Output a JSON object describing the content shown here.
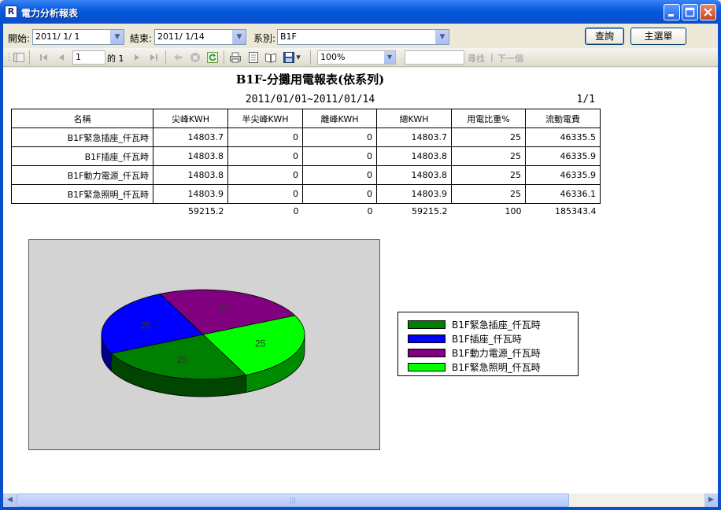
{
  "window": {
    "title": "電力分析報表",
    "icon": "R"
  },
  "filters": {
    "start_label": "開始:",
    "start_value": "2011/ 1/ 1",
    "end_label": "結束:",
    "end_value": "2011/ 1/14",
    "system_label": "系別:",
    "system_value": "B1F",
    "query_button": "查詢",
    "main_menu_button": "主選單"
  },
  "toolbar": {
    "page_input": "1",
    "page_of": "的 1",
    "zoom": "100%",
    "find_label": "尋找",
    "next_label": "下一個"
  },
  "report": {
    "title": "B1F-分攤用電報表(依系列)",
    "date_range": "2011/01/01~2011/01/14",
    "page_indicator": "1/1",
    "headers": [
      "名稱",
      "尖峰KWH",
      "半尖峰KWH",
      "離峰KWH",
      "總KWH",
      "用電比重%",
      "流動電費"
    ],
    "rows": [
      [
        "B1F緊急插座_仟瓦時",
        "14803.7",
        "0",
        "0",
        "14803.7",
        "25",
        "46335.5"
      ],
      [
        "B1F插座_仟瓦時",
        "14803.8",
        "0",
        "0",
        "14803.8",
        "25",
        "46335.9"
      ],
      [
        "B1F動力電源_仟瓦時",
        "14803.8",
        "0",
        "0",
        "14803.8",
        "25",
        "46335.9"
      ],
      [
        "B1F緊急照明_仟瓦時",
        "14803.9",
        "0",
        "0",
        "14803.9",
        "25",
        "46336.1"
      ]
    ],
    "totals": [
      "",
      "59215.2",
      "0",
      "0",
      "59215.2",
      "100",
      "185343.4"
    ]
  },
  "chart_data": {
    "type": "pie",
    "categories": [
      "B1F緊急插座_仟瓦時",
      "B1F插座_仟瓦時",
      "B1F動力電源_仟瓦時",
      "B1F緊急照明_仟瓦時"
    ],
    "values": [
      25,
      25,
      25,
      25
    ],
    "colors": [
      "#008000",
      "#0000ff",
      "#800080",
      "#00ff00"
    ],
    "legend": "right",
    "style": "3d"
  }
}
